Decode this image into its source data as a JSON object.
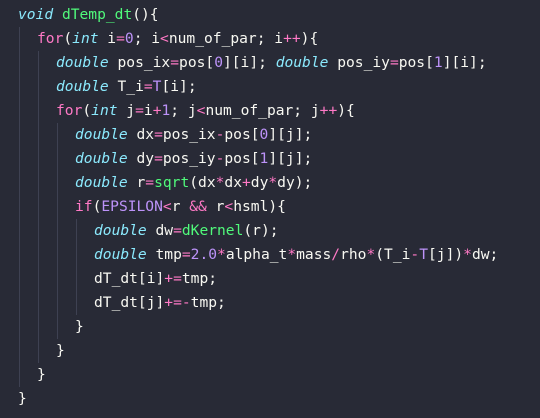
{
  "editor": {
    "theme_colors": {
      "background": "#282a36",
      "foreground": "#f8f8f2",
      "type": "#8be9fd",
      "keyword": "#ff79c6",
      "number": "#bd93f9",
      "function": "#50fa7b",
      "guide": "#3e4152"
    },
    "lines": [
      {
        "indent": 0,
        "tokens": [
          {
            "t": "void",
            "c": "type"
          },
          {
            "t": " dTemp_dt",
            "c": "fn"
          },
          {
            "t": "(){",
            "c": "punc"
          }
        ]
      },
      {
        "indent": 1,
        "tokens": [
          {
            "t": "for",
            "c": "kw"
          },
          {
            "t": "(",
            "c": "punc"
          },
          {
            "t": "int",
            "c": "type"
          },
          {
            "t": " i",
            "c": "id"
          },
          {
            "t": "=",
            "c": "op"
          },
          {
            "t": "0",
            "c": "num"
          },
          {
            "t": "; i",
            "c": "id"
          },
          {
            "t": "<",
            "c": "op"
          },
          {
            "t": "num_of_par; i",
            "c": "id"
          },
          {
            "t": "++",
            "c": "op"
          },
          {
            "t": "){",
            "c": "punc"
          }
        ]
      },
      {
        "indent": 2,
        "tokens": [
          {
            "t": "double",
            "c": "type"
          },
          {
            "t": " pos_ix",
            "c": "id"
          },
          {
            "t": "=",
            "c": "op"
          },
          {
            "t": "pos[",
            "c": "id"
          },
          {
            "t": "0",
            "c": "num"
          },
          {
            "t": "][i]; ",
            "c": "id"
          },
          {
            "t": "double",
            "c": "type"
          },
          {
            "t": " pos_iy",
            "c": "id"
          },
          {
            "t": "=",
            "c": "op"
          },
          {
            "t": "pos[",
            "c": "id"
          },
          {
            "t": "1",
            "c": "num"
          },
          {
            "t": "][i];",
            "c": "id"
          }
        ]
      },
      {
        "indent": 2,
        "tokens": [
          {
            "t": "double",
            "c": "type"
          },
          {
            "t": " T_i",
            "c": "id"
          },
          {
            "t": "=",
            "c": "op"
          },
          {
            "t": "T",
            "c": "const"
          },
          {
            "t": "[i];",
            "c": "id"
          }
        ]
      },
      {
        "indent": 2,
        "tokens": [
          {
            "t": "for",
            "c": "kw"
          },
          {
            "t": "(",
            "c": "punc"
          },
          {
            "t": "int",
            "c": "type"
          },
          {
            "t": " j",
            "c": "id"
          },
          {
            "t": "=",
            "c": "op"
          },
          {
            "t": "i",
            "c": "id"
          },
          {
            "t": "+",
            "c": "op"
          },
          {
            "t": "1",
            "c": "num"
          },
          {
            "t": "; j",
            "c": "id"
          },
          {
            "t": "<",
            "c": "op"
          },
          {
            "t": "num_of_par; j",
            "c": "id"
          },
          {
            "t": "++",
            "c": "op"
          },
          {
            "t": "){",
            "c": "punc"
          }
        ]
      },
      {
        "indent": 3,
        "tokens": [
          {
            "t": "double",
            "c": "type"
          },
          {
            "t": " dx",
            "c": "id"
          },
          {
            "t": "=",
            "c": "op"
          },
          {
            "t": "pos_ix",
            "c": "id"
          },
          {
            "t": "-",
            "c": "op"
          },
          {
            "t": "pos[",
            "c": "id"
          },
          {
            "t": "0",
            "c": "num"
          },
          {
            "t": "][j];",
            "c": "id"
          }
        ]
      },
      {
        "indent": 3,
        "tokens": [
          {
            "t": "double",
            "c": "type"
          },
          {
            "t": " dy",
            "c": "id"
          },
          {
            "t": "=",
            "c": "op"
          },
          {
            "t": "pos_iy",
            "c": "id"
          },
          {
            "t": "-",
            "c": "op"
          },
          {
            "t": "pos[",
            "c": "id"
          },
          {
            "t": "1",
            "c": "num"
          },
          {
            "t": "][j];",
            "c": "id"
          }
        ]
      },
      {
        "indent": 3,
        "tokens": [
          {
            "t": "double",
            "c": "type"
          },
          {
            "t": " r",
            "c": "id"
          },
          {
            "t": "=",
            "c": "op"
          },
          {
            "t": "sqrt",
            "c": "fn"
          },
          {
            "t": "(dx",
            "c": "id"
          },
          {
            "t": "*",
            "c": "op"
          },
          {
            "t": "dx",
            "c": "id"
          },
          {
            "t": "+",
            "c": "op"
          },
          {
            "t": "dy",
            "c": "id"
          },
          {
            "t": "*",
            "c": "op"
          },
          {
            "t": "dy);",
            "c": "id"
          }
        ]
      },
      {
        "indent": 3,
        "tokens": [
          {
            "t": "if",
            "c": "kw"
          },
          {
            "t": "(",
            "c": "punc"
          },
          {
            "t": "EPSILON",
            "c": "const"
          },
          {
            "t": "<",
            "c": "op"
          },
          {
            "t": "r ",
            "c": "id"
          },
          {
            "t": "&&",
            "c": "op"
          },
          {
            "t": " r",
            "c": "id"
          },
          {
            "t": "<",
            "c": "op"
          },
          {
            "t": "hsml){",
            "c": "id"
          }
        ]
      },
      {
        "indent": 4,
        "tokens": [
          {
            "t": "double",
            "c": "type"
          },
          {
            "t": " dw",
            "c": "id"
          },
          {
            "t": "=",
            "c": "op"
          },
          {
            "t": "dKernel",
            "c": "fn"
          },
          {
            "t": "(r);",
            "c": "id"
          }
        ]
      },
      {
        "indent": 4,
        "tokens": [
          {
            "t": "double",
            "c": "type"
          },
          {
            "t": " tmp",
            "c": "id"
          },
          {
            "t": "=",
            "c": "op"
          },
          {
            "t": "2.0",
            "c": "num"
          },
          {
            "t": "*",
            "c": "op"
          },
          {
            "t": "alpha_t",
            "c": "id"
          },
          {
            "t": "*",
            "c": "op"
          },
          {
            "t": "mass",
            "c": "id"
          },
          {
            "t": "/",
            "c": "op"
          },
          {
            "t": "rho",
            "c": "id"
          },
          {
            "t": "*",
            "c": "op"
          },
          {
            "t": "(T_i",
            "c": "id"
          },
          {
            "t": "-",
            "c": "op"
          },
          {
            "t": "T",
            "c": "const"
          },
          {
            "t": "[j])",
            "c": "id"
          },
          {
            "t": "*",
            "c": "op"
          },
          {
            "t": "dw;",
            "c": "id"
          }
        ]
      },
      {
        "indent": 4,
        "tokens": [
          {
            "t": "dT_dt[i]",
            "c": "id"
          },
          {
            "t": "+=",
            "c": "op"
          },
          {
            "t": "tmp;",
            "c": "id"
          }
        ]
      },
      {
        "indent": 4,
        "tokens": [
          {
            "t": "dT_dt[j]",
            "c": "id"
          },
          {
            "t": "+=-",
            "c": "op"
          },
          {
            "t": "tmp;",
            "c": "id"
          }
        ]
      },
      {
        "indent": 3,
        "tokens": [
          {
            "t": "}",
            "c": "punc"
          }
        ]
      },
      {
        "indent": 2,
        "tokens": [
          {
            "t": "}",
            "c": "punc"
          }
        ]
      },
      {
        "indent": 1,
        "tokens": [
          {
            "t": "}",
            "c": "punc"
          }
        ]
      },
      {
        "indent": 0,
        "tokens": [
          {
            "t": "}",
            "c": "punc"
          }
        ]
      }
    ]
  }
}
